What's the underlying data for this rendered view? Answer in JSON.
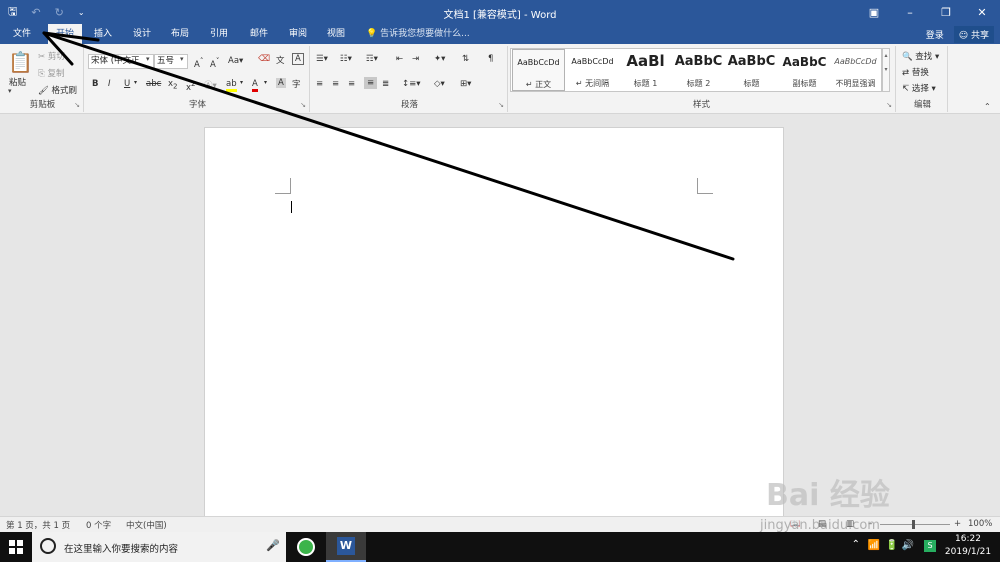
{
  "window": {
    "title": "文档1 [兼容模式] - Word",
    "qat": {
      "save_icon": "save-icon",
      "undo_icon": "undo-icon",
      "redo_icon": "redo-icon",
      "customize_icon": "customize-qat-icon"
    }
  },
  "tabs": [
    {
      "label": "文件"
    },
    {
      "label": "开始",
      "active": true
    },
    {
      "label": "插入"
    },
    {
      "label": "设计"
    },
    {
      "label": "布局"
    },
    {
      "label": "引用"
    },
    {
      "label": "邮件"
    },
    {
      "label": "审阅"
    },
    {
      "label": "视图"
    }
  ],
  "tell_me": "告诉我您想要做什么...",
  "account": {
    "login": "登录",
    "share": "共享"
  },
  "ribbon": {
    "clipboard": {
      "label": "剪贴板",
      "paste": "粘贴",
      "cut": "剪切",
      "copy": "复制",
      "format_painter": "格式刷"
    },
    "font": {
      "label": "字体",
      "font_name": "宋体 (中文正",
      "font_size": "五号",
      "case_btn": "Aa"
    },
    "paragraph": {
      "label": "段落"
    },
    "styles": {
      "label": "样式",
      "items": [
        {
          "preview": "AaBbCcDd",
          "name": "↵ 正文"
        },
        {
          "preview": "AaBbCcDd",
          "name": "↵ 无间隔"
        },
        {
          "preview": "AaBl",
          "name": "标题 1"
        },
        {
          "preview": "AaBbC",
          "name": "标题 2"
        },
        {
          "preview": "AaBbC",
          "name": "标题"
        },
        {
          "preview": "AaBbC",
          "name": "副标题"
        },
        {
          "preview": "AaBbCcDd",
          "name": "不明显强调"
        }
      ]
    },
    "editing": {
      "label": "编辑",
      "find": "查找",
      "replace": "替换",
      "select": "选择"
    }
  },
  "status": {
    "page": "第 1 页，共 1 页",
    "words": "0 个字",
    "lang": "中文(中国)",
    "zoom": "100%"
  },
  "taskbar": {
    "search_placeholder": "在这里输入你要搜索的内容",
    "word_app": "W",
    "time": "16:22",
    "date": "2019/1/21"
  },
  "watermark": {
    "text": "Bai 经验",
    "url": "jingyan.baidu.com"
  },
  "colors": {
    "accent": "#2b579a",
    "ribbon": "#f3f3f3",
    "annotation": "#000000"
  }
}
